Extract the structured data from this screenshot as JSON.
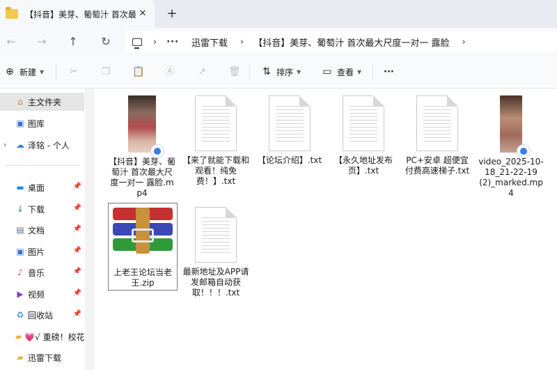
{
  "tab": {
    "title": "【抖音】美芽、葡萄汁 首次最",
    "close": "✕",
    "new_tab": "+"
  },
  "nav": {
    "back": "←",
    "forward": "→",
    "up": "↑",
    "refresh": "↻"
  },
  "address": {
    "sep": "›",
    "more": "···",
    "crumbs": [
      "迅雷下载",
      "【抖音】美芽、葡萄汁 首次最大尺度一对一 露脸"
    ]
  },
  "toolbar": {
    "new_label": "新建",
    "sort_label": "排序",
    "view_label": "查看",
    "more_label": "···"
  },
  "sidebar": {
    "items": [
      {
        "label": "主文件夹",
        "icon": "home-icon"
      },
      {
        "label": "图库",
        "icon": "gallery-icon"
      },
      {
        "label": "泽铭 - 个人",
        "icon": "cloud-icon"
      },
      {
        "label": "桌面",
        "icon": "desktop-icon"
      },
      {
        "label": "下载",
        "icon": "download-icon"
      },
      {
        "label": "文档",
        "icon": "documents-icon"
      },
      {
        "label": "图片",
        "icon": "pictures-icon"
      },
      {
        "label": "音乐",
        "icon": "music-icon"
      },
      {
        "label": "视频",
        "icon": "videos-icon"
      },
      {
        "label": "回收站",
        "icon": "recycle-bin-icon"
      },
      {
        "label": "💗√ 重磅！校花",
        "icon": "folder-icon"
      },
      {
        "label": "迅雷下载",
        "icon": "folder-icon"
      }
    ],
    "pin": "📌",
    "expand": "›"
  },
  "files": [
    {
      "name": "【抖音】美芽、葡萄汁 首次最大尺度一对一 露脸.mp4",
      "type": "video"
    },
    {
      "name": "【来了就能下载和观看！纯免费！】.txt",
      "type": "txt"
    },
    {
      "name": "【论坛介绍】.txt",
      "type": "txt"
    },
    {
      "name": "【永久地址发布页】.txt",
      "type": "txt"
    },
    {
      "name": "PC+安卓 超便宜付费高速梯子.txt",
      "type": "txt"
    },
    {
      "name": "video_2025-10-18_21-22-19 (2)_marked.mp4",
      "type": "video"
    },
    {
      "name": "上老王论坛当老王.zip",
      "type": "zip"
    },
    {
      "name": "最新地址及APP请发邮箱自动获取！！！.txt",
      "type": "txt"
    }
  ]
}
